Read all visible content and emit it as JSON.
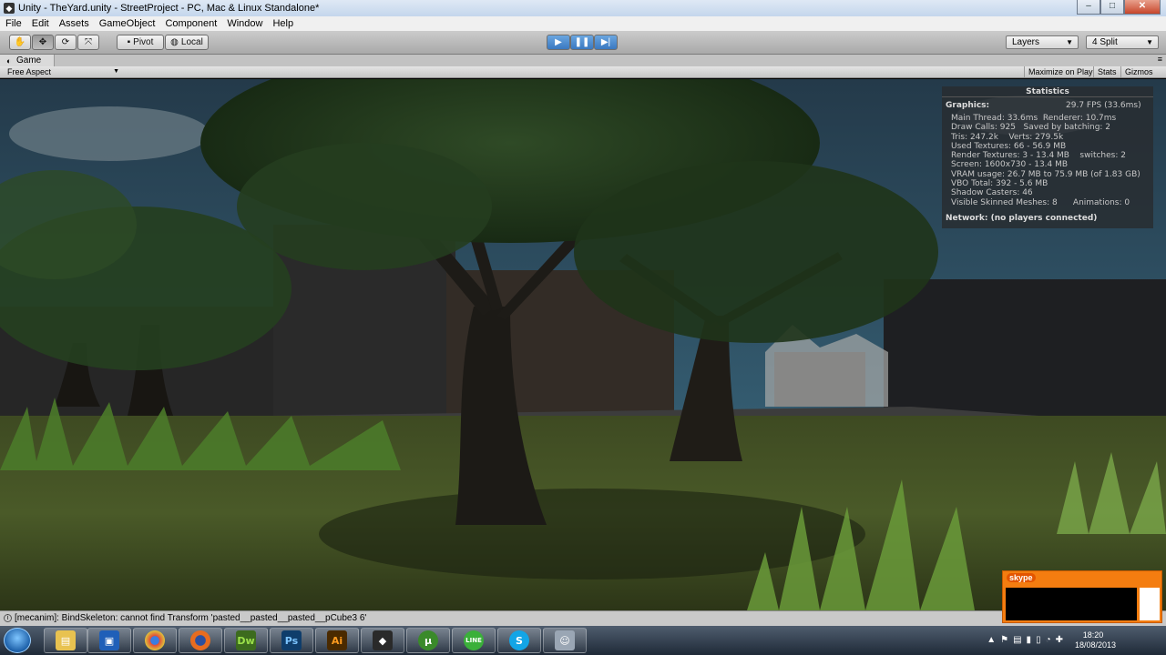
{
  "window": {
    "title": "Unity - TheYard.unity - StreetProject - PC, Mac & Linux Standalone*",
    "minimize": "–",
    "maximize": "□",
    "close": "✕"
  },
  "menu": [
    "File",
    "Edit",
    "Assets",
    "GameObject",
    "Component",
    "Window",
    "Help"
  ],
  "toolbar": {
    "pivot_label": "Pivot",
    "local_label": "Local",
    "layers_label": "Layers",
    "layout_label": "4 Split"
  },
  "game_tab": {
    "label": "Game"
  },
  "game_bar": {
    "aspect": "Free Aspect",
    "maximize": "Maximize on Play",
    "stats": "Stats",
    "gizmos": "Gizmos"
  },
  "statistics": {
    "title": "Statistics",
    "graphics_label": "Graphics:",
    "fps": "29.7 FPS (33.6ms)",
    "lines": "Main Thread: 33.6ms  Renderer: 10.7ms\nDraw Calls: 925   Saved by batching: 2\nTris: 247.2k    Verts: 279.5k\nUsed Textures: 66 - 56.9 MB\nRender Textures: 3 - 13.4 MB    switches: 2\nScreen: 1600x730 - 13.4 MB\nVRAM usage: 26.7 MB to 75.9 MB (of 1.83 GB)\nVBO Total: 392 - 5.6 MB\nShadow Casters: 46\nVisible Skinned Meshes: 8      Animations: 0",
    "network": "Network: (no players connected)"
  },
  "console": {
    "message": "[mecanim]: BindSkeleton: cannot find Transform 'pasted__pasted__pasted__pCube3 6'"
  },
  "taskbar": {
    "apps": [
      "explorer",
      "app-blue",
      "chrome",
      "firefox",
      "Dw",
      "Ps",
      "Ai",
      "unity",
      "utorrent",
      "LINE",
      "skype",
      "finder"
    ],
    "time": "18:20",
    "date": "18/08/2013"
  },
  "skype_popup": {
    "logo": "skype"
  }
}
